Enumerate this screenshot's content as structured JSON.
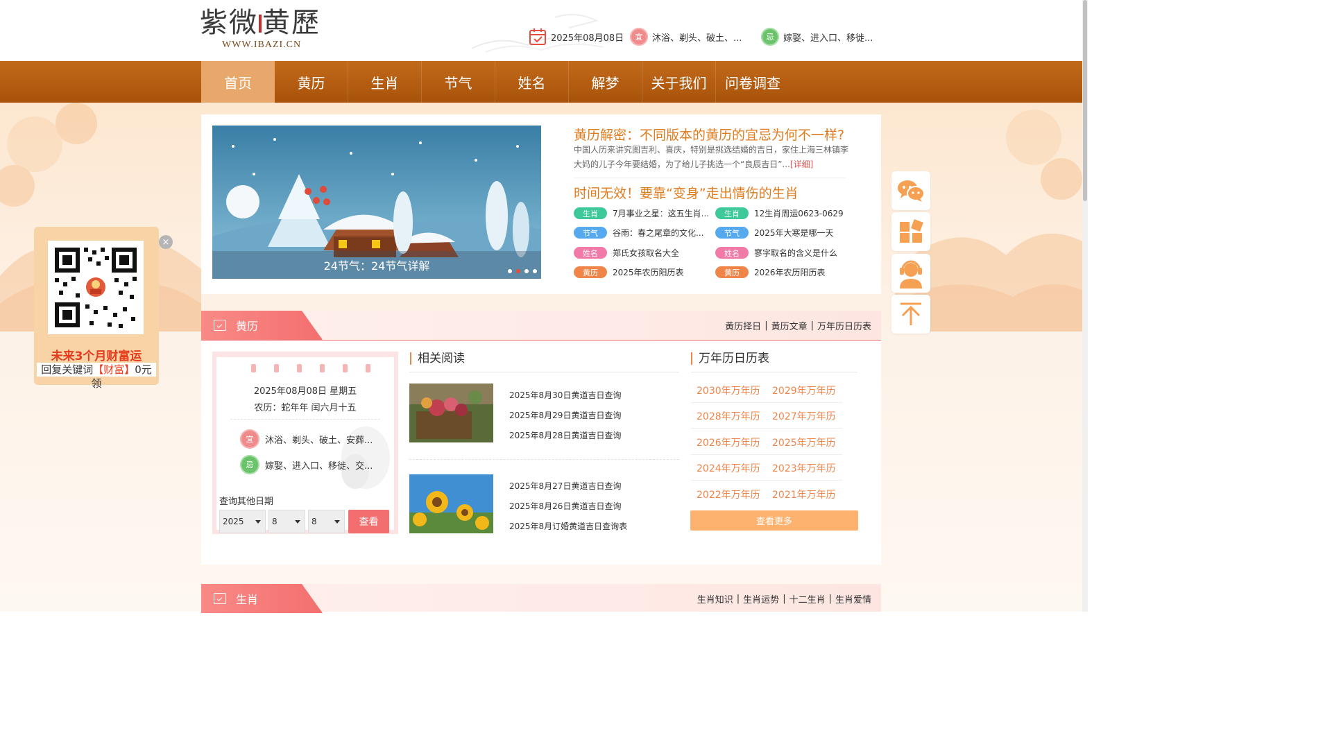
{
  "header": {
    "logo_cn_a": "紫微",
    "logo_cn_b": "黄歷",
    "logo_url": "WWW.IBAZI.CN",
    "date": "2025年08月08日",
    "yi_icon": "宜",
    "yi_text": "沐浴、剃头、破土、...",
    "ji_icon": "忌",
    "ji_text": "嫁娶、进入口、移徙..."
  },
  "nav": {
    "items": [
      "首页",
      "黄历",
      "生肖",
      "节气",
      "姓名",
      "解梦",
      "关于我们",
      "问卷调查"
    ],
    "active_index": 0
  },
  "banner": {
    "caption": "24节气：24节气详解",
    "slide_count": 4,
    "active_slide": 1
  },
  "featured": {
    "title1": "黄历解密：不同版本的黄历的宜忌为何不一样?",
    "text1": "中国人历来讲究图吉利、喜庆，特别是挑选结婚的吉日，家住上海三林镇李大妈的儿子今年要结婚，为了给儿子挑选一个“良辰吉日”...",
    "more": "[详细]",
    "title2": "时间无效！要靠“变身”走出情伤的生肖",
    "tags": [
      {
        "tag": "生肖",
        "text": "7月事业之星：这五生肖..."
      },
      {
        "tag": "生肖",
        "text": "12生肖周运0623-0629"
      },
      {
        "tag": "节气",
        "text": "谷雨：春之尾章的文化..."
      },
      {
        "tag": "节气",
        "text": "2025年大寒是哪一天"
      },
      {
        "tag": "姓名",
        "text": "郑氏女孩取名大全"
      },
      {
        "tag": "姓名",
        "text": "寥字取名的含义是什么"
      },
      {
        "tag": "黄历",
        "text": "2025年农历阳历表"
      },
      {
        "tag": "黄历",
        "text": "2026年农历阳历表"
      }
    ]
  },
  "section_huangli": {
    "title": "黄历",
    "links": [
      "黄历择日",
      "黄历文章",
      "万年历日历表"
    ]
  },
  "almanac": {
    "date_line": "2025年08月08日 星期五",
    "lunar_line": "农历：蛇年年 闰六月十五",
    "yi_icon": "宜",
    "yi_text": "沐浴、剃头、破土、安葬...",
    "ji_icon": "忌",
    "ji_text": "嫁娶、进入口、移徙、交...",
    "query_label": "查询其他日期",
    "year": "2025",
    "month": "8",
    "day": "8",
    "button": "查看"
  },
  "related": {
    "title": "相关阅读",
    "group1": [
      "2025年8月30日黄道吉日查询",
      "2025年8月29日黄道吉日查询",
      "2025年8月28日黄道吉日查询"
    ],
    "group2": [
      "2025年8月27日黄道吉日查询",
      "2025年8月26日黄道吉日查询",
      "2025年8月订婚黄道吉日查询表"
    ]
  },
  "wannianli": {
    "title": "万年历日历表",
    "items": [
      "2030年万年历",
      "2029年万年历",
      "2028年万年历",
      "2027年万年历",
      "2026年万年历",
      "2025年万年历",
      "2024年万年历",
      "2023年万年历",
      "2022年万年历",
      "2021年万年历"
    ],
    "more": "查看更多"
  },
  "section_shengxiao": {
    "title": "生肖",
    "links": [
      "生肖知识",
      "生肖运势",
      "十二生肖",
      "生肖爱情"
    ]
  },
  "qr_popup": {
    "line1": "未来3个月财富运",
    "line2_a": "回复关键词",
    "line2_b": "【财富】",
    "line2_c": "0元领",
    "close": "×"
  },
  "float_buttons": [
    "wechat-icon",
    "apps-icon",
    "customer-service-icon",
    "back-to-top-icon"
  ],
  "colors": {
    "nav_brown": "#b35e12",
    "accent_orange": "#e07b1d",
    "section_red": "#f36f6f"
  }
}
